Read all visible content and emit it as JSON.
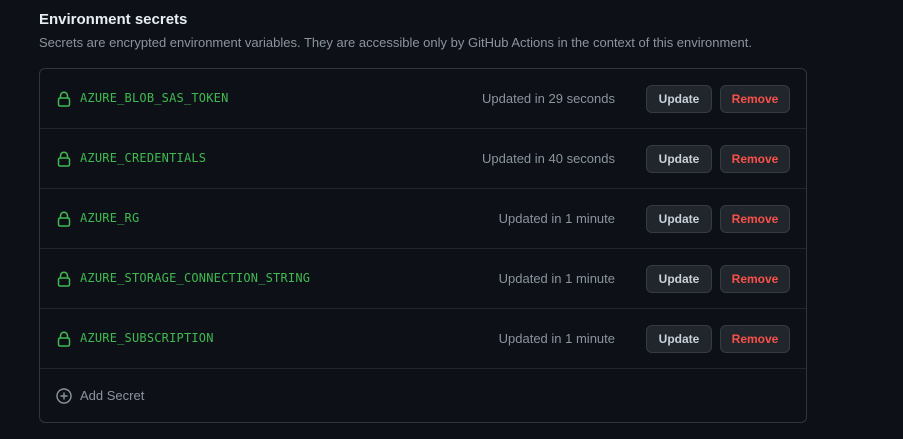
{
  "section": {
    "title": "Environment secrets",
    "description": "Secrets are encrypted environment variables. They are accessible only by GitHub Actions in the context of this environment."
  },
  "secrets": [
    {
      "name": "AZURE_BLOB_SAS_TOKEN",
      "updated": "Updated in 29 seconds",
      "update_label": "Update",
      "remove_label": "Remove"
    },
    {
      "name": "AZURE_CREDENTIALS",
      "updated": "Updated in 40 seconds",
      "update_label": "Update",
      "remove_label": "Remove"
    },
    {
      "name": "AZURE_RG",
      "updated": "Updated in 1 minute",
      "update_label": "Update",
      "remove_label": "Remove"
    },
    {
      "name": "AZURE_STORAGE_CONNECTION_STRING",
      "updated": "Updated in 1 minute",
      "update_label": "Update",
      "remove_label": "Remove"
    },
    {
      "name": "AZURE_SUBSCRIPTION",
      "updated": "Updated in 1 minute",
      "update_label": "Update",
      "remove_label": "Remove"
    }
  ],
  "add_secret": {
    "label": "Add Secret",
    "icon": "plus-circle-icon"
  },
  "icons": {
    "secret": "lock-icon"
  },
  "colors": {
    "background": "#0d1117",
    "secret_name": "#3fb950",
    "remove_text": "#f85149",
    "muted_text": "#8b949e",
    "border": "#30363d"
  }
}
